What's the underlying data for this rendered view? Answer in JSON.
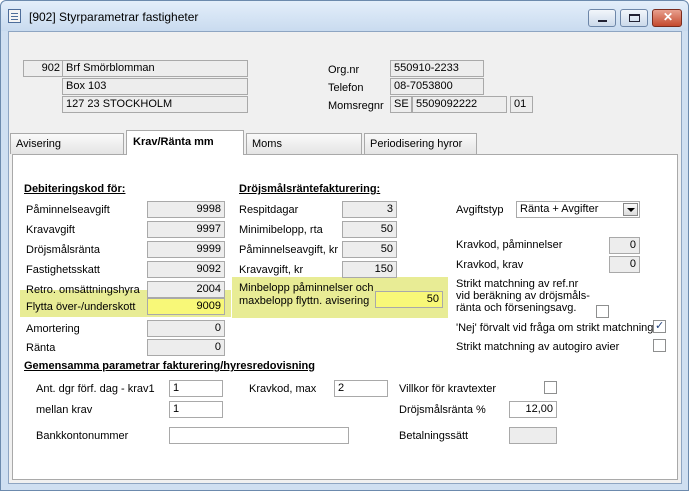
{
  "window": {
    "title": "[902]  Styrparametrar fastigheter"
  },
  "header": {
    "company_no": "902",
    "company_name": "Brf Smörblomman",
    "address": "Box 103",
    "postal": "127 23  STOCKHOLM",
    "orgnr_label": "Org.nr",
    "orgnr": "550910-2233",
    "phone_label": "Telefon",
    "phone": "08-7053800",
    "vat_label": "Momsregnr",
    "vat_prefix": "SE",
    "vat_number": "5509092222",
    "vat_suffix": "01"
  },
  "tabs": [
    {
      "label": "Avisering"
    },
    {
      "label": "Krav/Ränta mm",
      "active": true
    },
    {
      "label": "Moms"
    },
    {
      "label": "Periodisering hyror"
    }
  ],
  "debit": {
    "title": "Debiteringskod för:",
    "rows": [
      {
        "label": "Påminnelseavgift",
        "value": "9998"
      },
      {
        "label": "Kravavgift",
        "value": "9997"
      },
      {
        "label": "Dröjsmålsränta",
        "value": "9999"
      },
      {
        "label": "Fastighetsskatt",
        "value": "9092"
      },
      {
        "label": "Retro. omsättningshyra",
        "value": "2004"
      },
      {
        "label": "Flytta över-/underskott",
        "value": "9009"
      },
      {
        "label": "Amortering",
        "value": "0"
      },
      {
        "label": "Ränta",
        "value": "0"
      }
    ]
  },
  "interest": {
    "title": "Dröjsmålsräntefakturering:",
    "rows": [
      {
        "label": "Respitdagar",
        "value": "3"
      },
      {
        "label": "Minimibelopp, rta",
        "value": "50"
      },
      {
        "label": "Påminnelseavgift, kr",
        "value": "50"
      },
      {
        "label": "Kravavgift, kr",
        "value": "150"
      }
    ],
    "min_amount_label_1": "Minbelopp påminnelser och",
    "min_amount_label_2": "maxbelopp flyttn. avisering",
    "min_amount_value": "50"
  },
  "right": {
    "fee_type_label": "Avgiftstyp",
    "fee_type_value": "Ränta + Avgifter",
    "reminder_code_label": "Kravkod, påminnelser",
    "reminder_code_value": "0",
    "demand_code_label": "Kravkod, krav",
    "demand_code_value": "0",
    "strict_1": "Strikt matchning av ref.nr",
    "strict_2": "vid beräkning av dröjsmåls-",
    "strict_3": "ränta och förseningsavg.",
    "nej_label": "'Nej' förvalt vid fråga om strikt matchning",
    "autogiro_label": "Strikt matchning av autogiro avier"
  },
  "common": {
    "title": "Gemensamma parametrar fakturering/hyresredovisning",
    "days_label": "Ant. dgr förf. dag - krav1",
    "days_value": "1",
    "between_label": "mellan krav",
    "between_value": "1",
    "bank_label": "Bankkontonummer",
    "bank_value": "",
    "maxcode_label": "Kravkod, max",
    "maxcode_value": "2",
    "conditions_label": "Villkor för kravtexter",
    "rate_label": "Dröjsmålsränta %",
    "rate_value": "12,00",
    "payment_label": "Betalningssätt",
    "payment_value": ""
  },
  "checkboxes": {
    "strict_checked": false,
    "nej_checked": true,
    "autogiro_checked": false,
    "conditions_checked": false
  },
  "colors": {
    "highlight": "#e8ec95",
    "highlight_field": "#f8f878",
    "window_frame": "#cfdff1"
  }
}
